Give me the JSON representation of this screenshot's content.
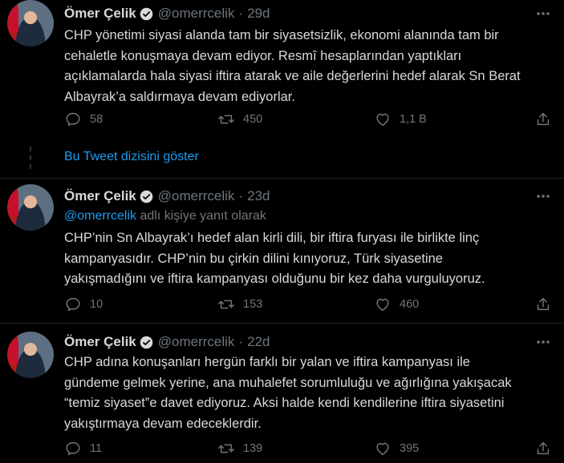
{
  "tweets": [
    {
      "author": "Ömer Çelik",
      "handle": "@omerrcelik",
      "separator": "·",
      "time": "29d",
      "replying_prefix": "",
      "replying_mention": "",
      "replying_suffix": "",
      "text": "CHP yönetimi siyasi alanda tam bir siyasetsizlik, ekonomi alanında tam bir\ncehaletle konuşmaya devam ediyor. Resmî hesaplarından yaptıkları\naçıklamalarda hala siyasi iftira atarak ve aile değerlerini hedef alarak Sn Berat\nAlbayrak’a saldırmaya devam ediyorlar.",
      "replies": "58",
      "retweets": "450",
      "likes": "1,1 B"
    },
    {
      "author": "Ömer Çelik",
      "handle": "@omerrcelik",
      "separator": "·",
      "time": "23d",
      "replying_prefix": "",
      "replying_mention": "@omerrcelik",
      "replying_suffix": " adlı kişiye yanıt olarak",
      "text": "CHP’nin Sn Albayrak’ı hedef alan kirli dili, bir iftira furyası ile birlikte linç\nkampanyasıdır. CHP’nin bu çirkin dilini kınıyoruz, Türk siyasetine\nyakışmadığını ve iftira kampanyası olduğunu bir kez daha vurguluyoruz.",
      "replies": "10",
      "retweets": "153",
      "likes": "460"
    },
    {
      "author": "Ömer Çelik",
      "handle": "@omerrcelik",
      "separator": "·",
      "time": "22d",
      "replying_prefix": "",
      "replying_mention": "",
      "replying_suffix": "",
      "text": "CHP adına konuşanları hergün farklı bir yalan ve iftira kampanyası ile\ngündeme gelmek yerine, ana muhalefet sorumluluğu ve ağırlığına yakışacak\n“temiz siyaset”e davet ediyoruz. Aksi halde kendi kendilerine iftira siyasetini\nyakıştırmaya devam edeceklerdir.",
      "replies": "11",
      "retweets": "139",
      "likes": "395"
    }
  ],
  "show_thread": "Bu Tweet dizisini göster",
  "colors": {
    "background": "#000000",
    "text": "#d9d9d9",
    "secondary": "#6e767d",
    "accent": "#1d9bf0"
  },
  "icons": {
    "verified": "verified-badge-icon",
    "more": "more-dots-icon",
    "reply": "reply-icon",
    "retweet": "retweet-icon",
    "like": "like-icon",
    "share": "share-icon"
  }
}
